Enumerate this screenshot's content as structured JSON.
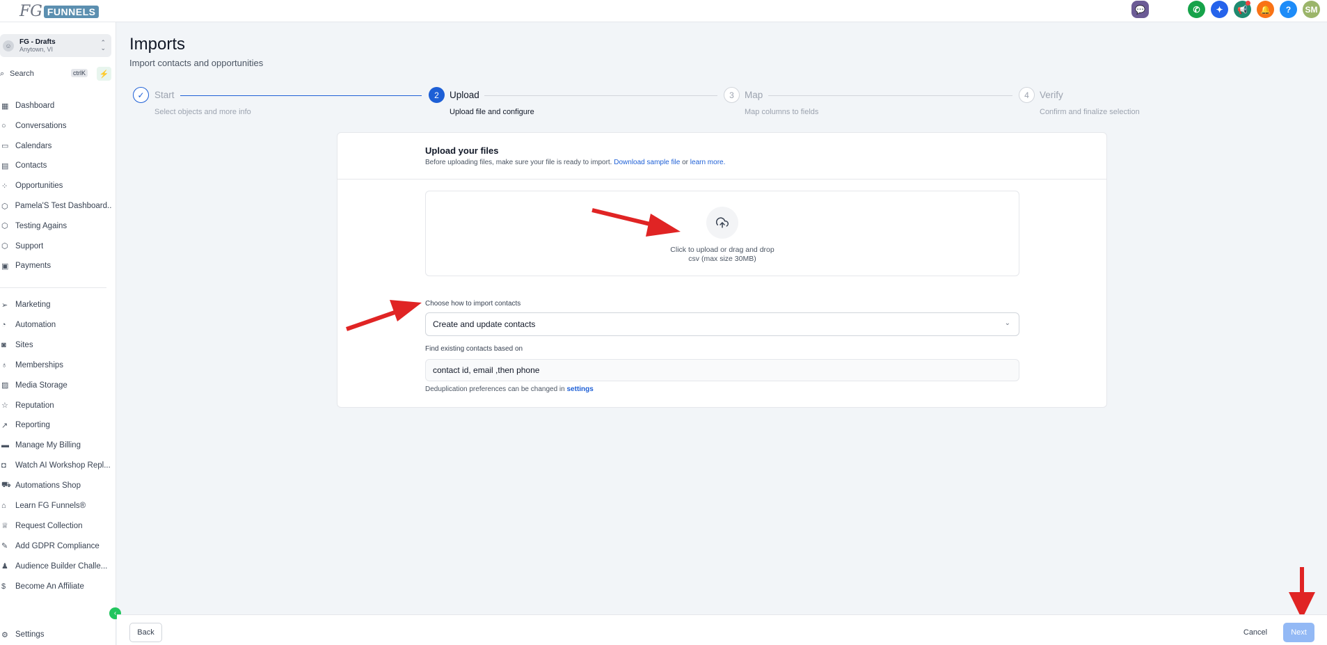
{
  "app": {
    "logo_prefix": "FG",
    "logo_brand": "FUNNELS"
  },
  "top_icons": [
    {
      "name": "chat-icon",
      "color": "#6b5b95",
      "glyph": "💬"
    },
    {
      "name": "phone-icon",
      "color": "#16a34a",
      "glyph": "✆"
    },
    {
      "name": "sparkle-icon",
      "color": "#2563eb",
      "glyph": "✦"
    },
    {
      "name": "megaphone-icon",
      "color": "#1f8a70",
      "glyph": "📢"
    },
    {
      "name": "bell-icon",
      "color": "#f97316",
      "glyph": "🔔"
    },
    {
      "name": "help-icon",
      "color": "#1d8cf8",
      "glyph": "?"
    },
    {
      "name": "avatar",
      "color": "#9bb56a",
      "glyph": "SM"
    }
  ],
  "account": {
    "name": "FG - Drafts",
    "location": "Anytown, VI"
  },
  "search": {
    "label": "Search",
    "shortcut": "ctrlK"
  },
  "sidebar": {
    "items": [
      {
        "label": "Dashboard",
        "icon": "dashboard-icon",
        "glyph": "▦"
      },
      {
        "label": "Conversations",
        "icon": "conversations-icon",
        "glyph": "○"
      },
      {
        "label": "Calendars",
        "icon": "calendar-icon",
        "glyph": "▭"
      },
      {
        "label": "Contacts",
        "icon": "contacts-icon",
        "glyph": "▤"
      },
      {
        "label": "Opportunities",
        "icon": "opportunities-icon",
        "glyph": "⁘"
      },
      {
        "label": "Pamela'S Test Dashboard...",
        "icon": "cube-icon",
        "glyph": "⬡"
      },
      {
        "label": "Testing Agains",
        "icon": "cube-icon",
        "glyph": "⬡"
      },
      {
        "label": "Support",
        "icon": "cube-icon",
        "glyph": "⬡"
      },
      {
        "label": "Payments",
        "icon": "payments-icon",
        "glyph": "▣"
      }
    ],
    "items2": [
      {
        "label": "Marketing",
        "icon": "send-icon",
        "glyph": "➢"
      },
      {
        "label": "Automation",
        "icon": "automation-icon",
        "glyph": "◔"
      },
      {
        "label": "Sites",
        "icon": "sites-icon",
        "glyph": "◙"
      },
      {
        "label": "Memberships",
        "icon": "award-icon",
        "glyph": "♁"
      },
      {
        "label": "Media Storage",
        "icon": "image-icon",
        "glyph": "▨"
      },
      {
        "label": "Reputation",
        "icon": "star-icon",
        "glyph": "☆"
      },
      {
        "label": "Reporting",
        "icon": "trend-icon",
        "glyph": "↗"
      },
      {
        "label": "Manage My Billing",
        "icon": "billing-icon",
        "glyph": "▬"
      },
      {
        "label": "Watch AI Workshop Repl...",
        "icon": "robot-icon",
        "glyph": "◘"
      },
      {
        "label": "Automations Shop",
        "icon": "cart-icon",
        "glyph": "⛟"
      },
      {
        "label": "Learn FG Funnels®",
        "icon": "graduation-icon",
        "glyph": "⌂"
      },
      {
        "label": "Request Collection",
        "icon": "trophy-icon",
        "glyph": "♕"
      },
      {
        "label": "Add GDPR Compliance",
        "icon": "signature-icon",
        "glyph": "✎"
      },
      {
        "label": "Audience Builder Challe...",
        "icon": "users-icon",
        "glyph": "♟"
      },
      {
        "label": "Become An Affiliate",
        "icon": "dollar-icon",
        "glyph": "$"
      }
    ],
    "settings": "Settings"
  },
  "page": {
    "title": "Imports",
    "subtitle": "Import contacts and opportunities"
  },
  "steps": [
    {
      "number": "✓",
      "label": "Start",
      "desc": "Select objects and more info",
      "state": "done"
    },
    {
      "number": "2",
      "label": "Upload",
      "desc": "Upload file and configure",
      "state": "active"
    },
    {
      "number": "3",
      "label": "Map",
      "desc": "Map columns to fields",
      "state": "pending"
    },
    {
      "number": "4",
      "label": "Verify",
      "desc": "Confirm and finalize selection",
      "state": "pending"
    }
  ],
  "upload": {
    "title": "Upload your files",
    "note": "Before uploading files, make sure your file is ready to import.",
    "sample_link": "Download sample file",
    "or": "or",
    "learn_link": "learn more.",
    "drop_text": "Click to upload or drag and drop",
    "drop_hint": "csv (max size 30MB)"
  },
  "import_mode": {
    "label": "Choose how to import contacts",
    "value": "Create and update contacts"
  },
  "match": {
    "label": "Find existing contacts based on",
    "value": "contact id, email ,then phone",
    "note": "Deduplication preferences can be changed in",
    "link": "settings"
  },
  "footer": {
    "back": "Back",
    "cancel": "Cancel",
    "next": "Next"
  },
  "colors": {
    "accent": "#1d5fd6",
    "annotation_arrow": "#e02424",
    "next_disabled": "#93b9f5"
  }
}
